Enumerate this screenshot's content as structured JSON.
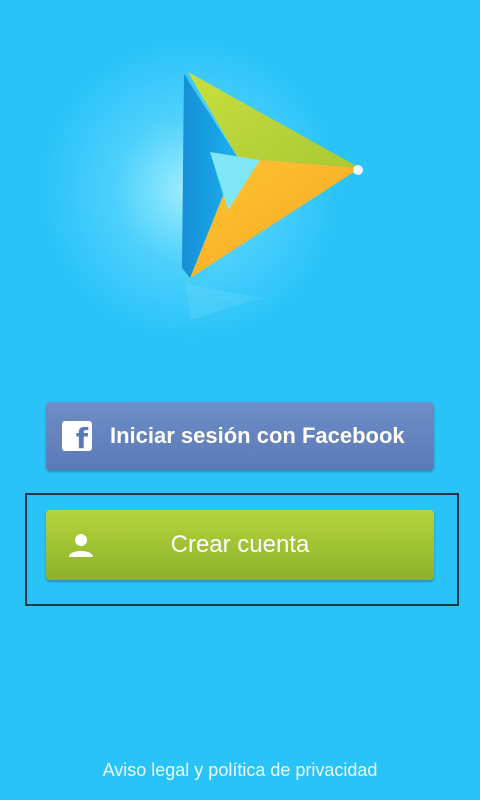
{
  "colors": {
    "background": "#2ac3f8",
    "facebook_button": "#5b79b7",
    "create_button": "#9dc22f",
    "logo_green": "#c0d93a",
    "logo_blue": "#1a9ee0",
    "logo_yellow": "#f8b42a"
  },
  "icons": {
    "logo": "play-triangle-logo",
    "facebook": "facebook-f-icon",
    "user": "person-icon"
  },
  "facebook_button": {
    "label": "Iniciar sesión con Facebook",
    "icon_glyph": "f"
  },
  "create_account_button": {
    "label": "Crear cuenta"
  },
  "footer": {
    "legal_link": "Aviso legal y política de privacidad"
  }
}
